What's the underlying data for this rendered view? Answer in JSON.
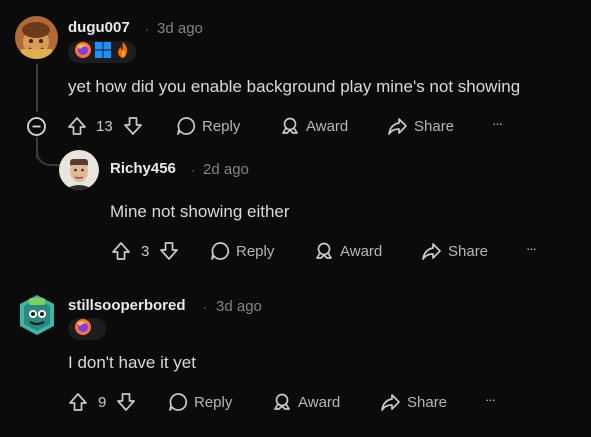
{
  "comments": [
    {
      "username": "dugu007",
      "separator": "·",
      "time": "3d ago",
      "body": "yet how did you enable background play mine's not showing",
      "votes": "13",
      "reply_label": "Reply",
      "award_label": "Award",
      "share_label": "Share",
      "more_label": "···"
    },
    {
      "username": "Richy456",
      "separator": "·",
      "time": "2d ago",
      "body": "Mine not showing either",
      "votes": "3",
      "reply_label": "Reply",
      "award_label": "Award",
      "share_label": "Share",
      "more_label": "···"
    },
    {
      "username": "stillsooperbored",
      "separator": "·",
      "time": "3d ago",
      "body": "I don't have it yet",
      "votes": "9",
      "reply_label": "Reply",
      "award_label": "Award",
      "share_label": "Share",
      "more_label": "···"
    }
  ],
  "colors": {
    "background": "#0b0b0c",
    "text": "#d7dadc",
    "muted": "#818384",
    "thread_line": "#3a3a3c"
  },
  "icons": [
    "collapse-thread-icon",
    "upvote-icon",
    "downvote-icon",
    "reply-icon",
    "award-icon",
    "share-icon",
    "firefox-icon",
    "windows-icon",
    "reddit-flame-icon"
  ]
}
